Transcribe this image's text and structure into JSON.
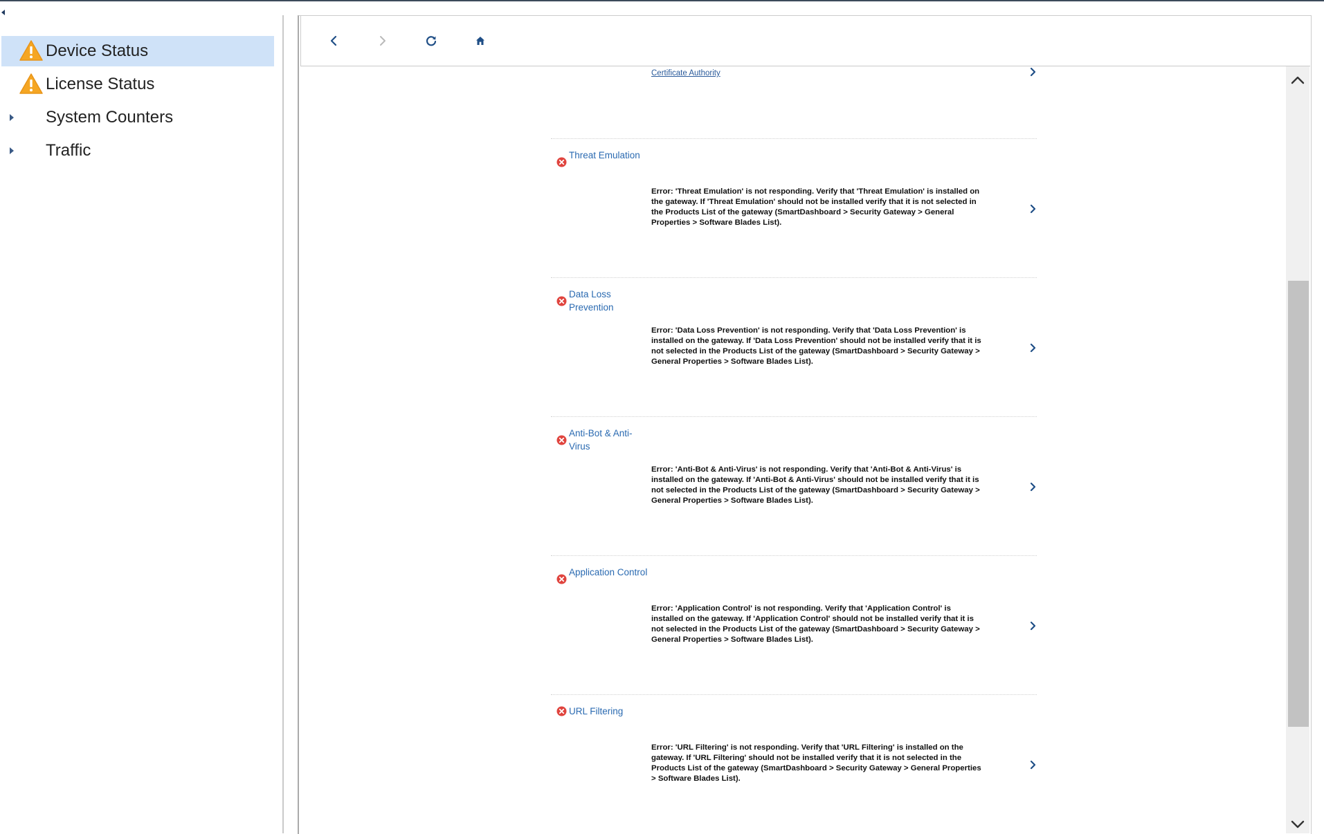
{
  "sidebar": {
    "items": [
      {
        "label": "Device Status",
        "icon": "warning-icon",
        "selected": true
      },
      {
        "label": "License Status",
        "icon": "warning-icon",
        "selected": false
      },
      {
        "label": "System Counters",
        "icon": "expand-arrow-icon",
        "selected": false
      },
      {
        "label": "Traffic",
        "icon": "expand-arrow-icon",
        "selected": false
      }
    ]
  },
  "toolbar": {
    "buttons": [
      "back-icon",
      "forward-icon",
      "refresh-icon",
      "home-icon"
    ]
  },
  "content": {
    "partial_item": {
      "link": "Certificate Authority"
    },
    "items": [
      {
        "name": "Threat Emulation",
        "status": "error",
        "message": "Error: 'Threat Emulation' is not responding. Verify that 'Threat Emulation' is installed on the gateway. If 'Threat Emulation' should not be installed verify that it is not selected in the Products List of the gateway (SmartDashboard > Security Gateway > General Properties > Software Blades List)."
      },
      {
        "name": "Data Loss Prevention",
        "status": "error",
        "message": "Error: 'Data Loss Prevention' is not responding. Verify that 'Data Loss Prevention' is installed on the gateway. If 'Data Loss Prevention' should not be installed verify that it is not selected in the Products List of the gateway (SmartDashboard > Security Gateway > General Properties > Software Blades List)."
      },
      {
        "name": "Anti-Bot & Anti-Virus",
        "status": "error",
        "message": "Error: 'Anti-Bot & Anti-Virus' is not responding. Verify that 'Anti-Bot & Anti-Virus' is installed on the gateway. If 'Anti-Bot & Anti-Virus' should not be installed verify that it is not selected in the Products List of the gateway (SmartDashboard > Security Gateway > General Properties > Software Blades List)."
      },
      {
        "name": "Application Control",
        "status": "error",
        "message": "Error: 'Application Control' is not responding. Verify that 'Application Control' is installed on the gateway. If 'Application Control' should not be installed verify that it is not selected in the Products List of the gateway (SmartDashboard > Security Gateway > General Properties > Software Blades List)."
      },
      {
        "name": "URL Filtering",
        "status": "error",
        "message": "Error: 'URL Filtering' is not responding. Verify that 'URL Filtering' is installed on the gateway. If 'URL Filtering' should not be installed verify that it is not selected in the Products List of the gateway (SmartDashboard > Security Gateway > General Properties > Software Blades List)."
      }
    ]
  },
  "colors": {
    "selected_bg": "#cfe2f8",
    "link": "#2a6ab1",
    "error": "#e0443e",
    "warning": "#f5a623",
    "chevron": "#1f4e86"
  }
}
